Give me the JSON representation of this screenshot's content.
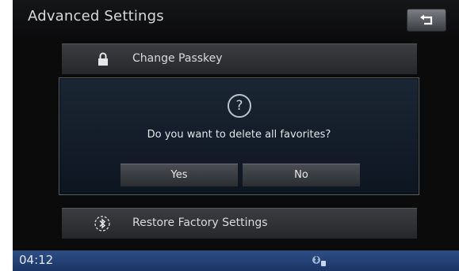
{
  "header": {
    "title": "Advanced Settings"
  },
  "menu": {
    "change_passkey": "Change Passkey",
    "restore_factory": "Restore Factory Settings"
  },
  "dialog": {
    "icon_glyph": "?",
    "message": "Do you want to delete all favorites?",
    "yes_label": "Yes",
    "no_label": "No"
  },
  "status_bar": {
    "time": "04:12"
  },
  "icons": {
    "back": "back-arrow-icon",
    "lock": "lock-icon",
    "restore": "bluetooth-restore-icon",
    "question": "question-icon",
    "status": "bluetooth-phone-icon"
  },
  "colors": {
    "background": "#0b0b0c",
    "dialog": "#1b2634",
    "status_bar": "#2d4f86"
  }
}
